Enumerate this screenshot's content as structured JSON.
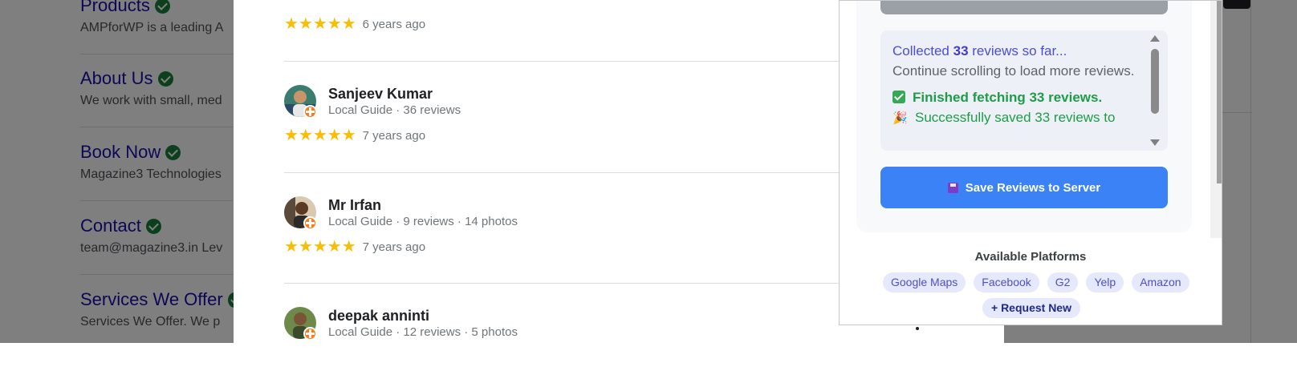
{
  "background_page": {
    "items": [
      {
        "title": "Products",
        "desc": "AMPforWP is a leading A"
      },
      {
        "title": "About Us",
        "desc": "We work with small, med"
      },
      {
        "title": "Book Now",
        "desc": "Magazine3 Technologies"
      },
      {
        "title": "Contact",
        "desc": "team@magazine3.in Lev"
      },
      {
        "title": "Services We Offer",
        "desc": "Services We Offer. We p"
      }
    ]
  },
  "reviews": {
    "top_time": "6 years ago",
    "items": [
      {
        "name": "Sanjeev Kumar",
        "meta": "Local Guide · 36 reviews",
        "stars": "★★★★★",
        "time": "7 years ago"
      },
      {
        "name": "Mr Irfan",
        "meta": "Local Guide · 9 reviews · 14 photos",
        "stars": "★★★★★",
        "time": "7 years ago"
      },
      {
        "name": "deepak anninti",
        "meta": "Local Guide · 12 reviews · 5 photos",
        "stars": "",
        "time": ""
      }
    ]
  },
  "extension": {
    "log": {
      "collected_prefix": "Collected ",
      "collected_count": "33",
      "collected_suffix": " reviews so far...",
      "continue": "Continue scrolling to load more reviews.",
      "finished": "Finished fetching 33 reviews.",
      "saved": "Successfully saved 33 reviews to"
    },
    "save_button": "Save Reviews to Server",
    "platforms_title": "Available Platforms",
    "platforms": [
      "Google Maps",
      "Facebook",
      "G2",
      "Yelp",
      "Amazon"
    ],
    "request_new": "+ Request New"
  },
  "colors": {
    "accent": "#3b82f6",
    "star": "#fbbc04",
    "success": "#1e9c48",
    "link": "#1a0dab"
  }
}
